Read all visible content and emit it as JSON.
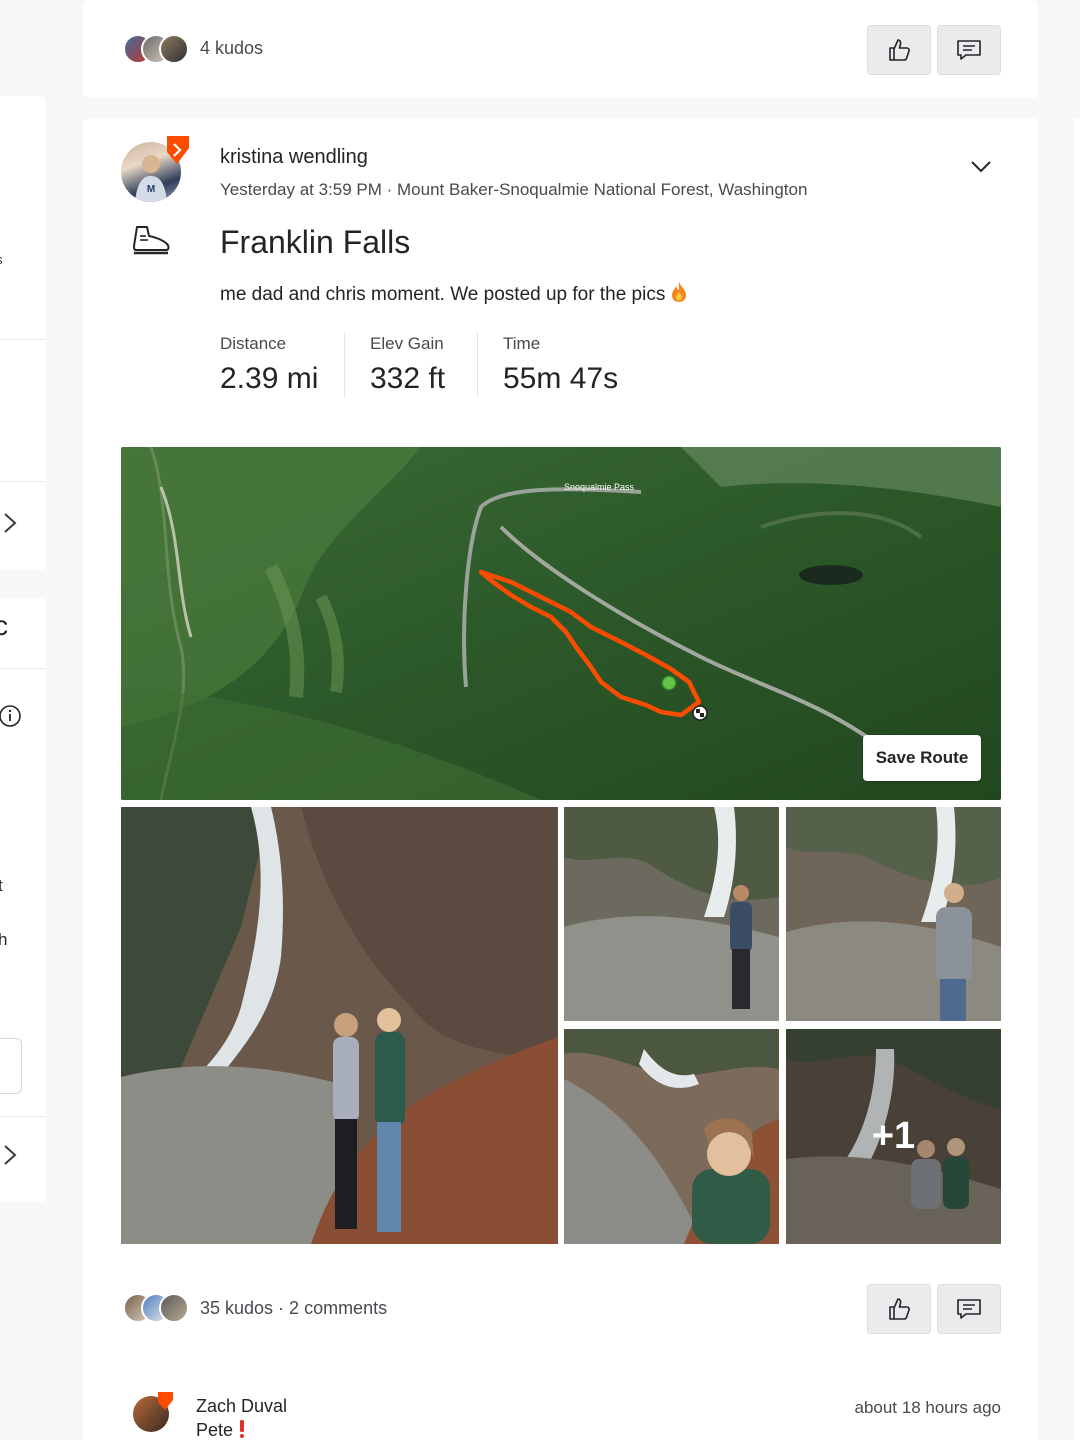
{
  "top_card": {
    "kudos": "4 kudos"
  },
  "activity": {
    "athlete_name": "kristina wendling",
    "meta": "Yesterday at 3:59 PM · Mount Baker-Snoqualmie National Forest, Washington",
    "title": "Franklin Falls",
    "description": "me dad and chris moment. We posted up for the pics",
    "activity_type_icon": "hiking-boot-icon",
    "stats": [
      {
        "label": "Distance",
        "value": "2.39 mi"
      },
      {
        "label": "Elev Gain",
        "value": "332 ft"
      },
      {
        "label": "Time",
        "value": "55m 47s"
      }
    ],
    "map": {
      "place_label": "Snoqualmie Pass",
      "save_route_label": "Save Route",
      "route_color": "#fc4c02"
    },
    "photos_more": "+1",
    "kudos_comments": "35 kudos · 2 comments"
  },
  "comment": {
    "name": "Zach Duval",
    "text": "Pete",
    "time": "about 18 hours ago"
  },
  "colors": {
    "accent": "#fc4c02",
    "background": "#f7f7fa",
    "button_bg": "#ebebee"
  }
}
